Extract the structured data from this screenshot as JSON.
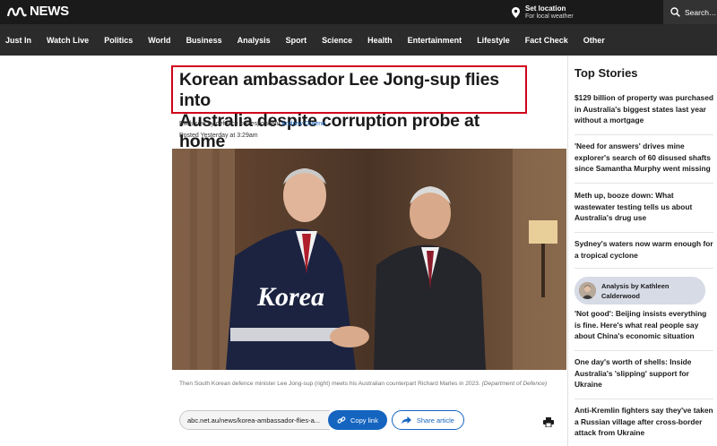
{
  "header": {
    "logo_text": "NEWS",
    "location_title": "Set location",
    "location_sub": "For local weather",
    "search_label": "Search…"
  },
  "nav": {
    "items": [
      "Just In",
      "Watch Live",
      "Politics",
      "World",
      "Business",
      "Analysis",
      "Sport",
      "Science",
      "Health",
      "Entertainment",
      "Lifestyle",
      "Fact Check",
      "Other"
    ]
  },
  "article": {
    "headline_line1": "Korean ambassador Lee Jong-sup flies into",
    "headline_line2": "Australia despite corruption probe at home",
    "byline_prefix": "Exclusive by defence correspondent",
    "author": "Andrew Greene",
    "posted": "Posted Yesterday at 3:29am",
    "image_jacket_text": "Korea",
    "caption": "Then South Korean defence minister Lee Jong-sup (right) meets his Australian counterpart Richard Marles in 2023.",
    "caption_credit": "(Department of Defence)",
    "url": "abc.net.au/news/korea-ambassador-flies-a...",
    "copy_label": "Copy link",
    "share_label": "Share article"
  },
  "sidebar": {
    "title": "Top Stories",
    "stories": [
      "$129 billion of property was purchased in Australia's biggest states last year without a mortgage",
      "'Need for answers' drives mine explorer's search of 60 disused shafts since Samantha Murphy went missing",
      "Meth up, booze down: What wastewater testing tells us about Australia's drug use",
      "Sydney's waters now warm enough for a tropical cyclone",
      "'Not good': Beijing insists everything is fine. Here's what real people say about China's economic situation",
      "One day's worth of shells: Inside Australia's 'slipping' support for Ukraine",
      "Anti-Kremlin fighters say they've taken a Russian village after cross-border attack from Ukraine"
    ],
    "analysis_line1": "Analysis by Kathleen",
    "analysis_line2": "Calderwood"
  },
  "colors": {
    "topbar": "#1a1a1a",
    "navbar": "#2b2b2b",
    "accent_blue": "#1565c0",
    "highlight_red": "#d0021b",
    "analysis_pill": "#d6dbe6"
  }
}
